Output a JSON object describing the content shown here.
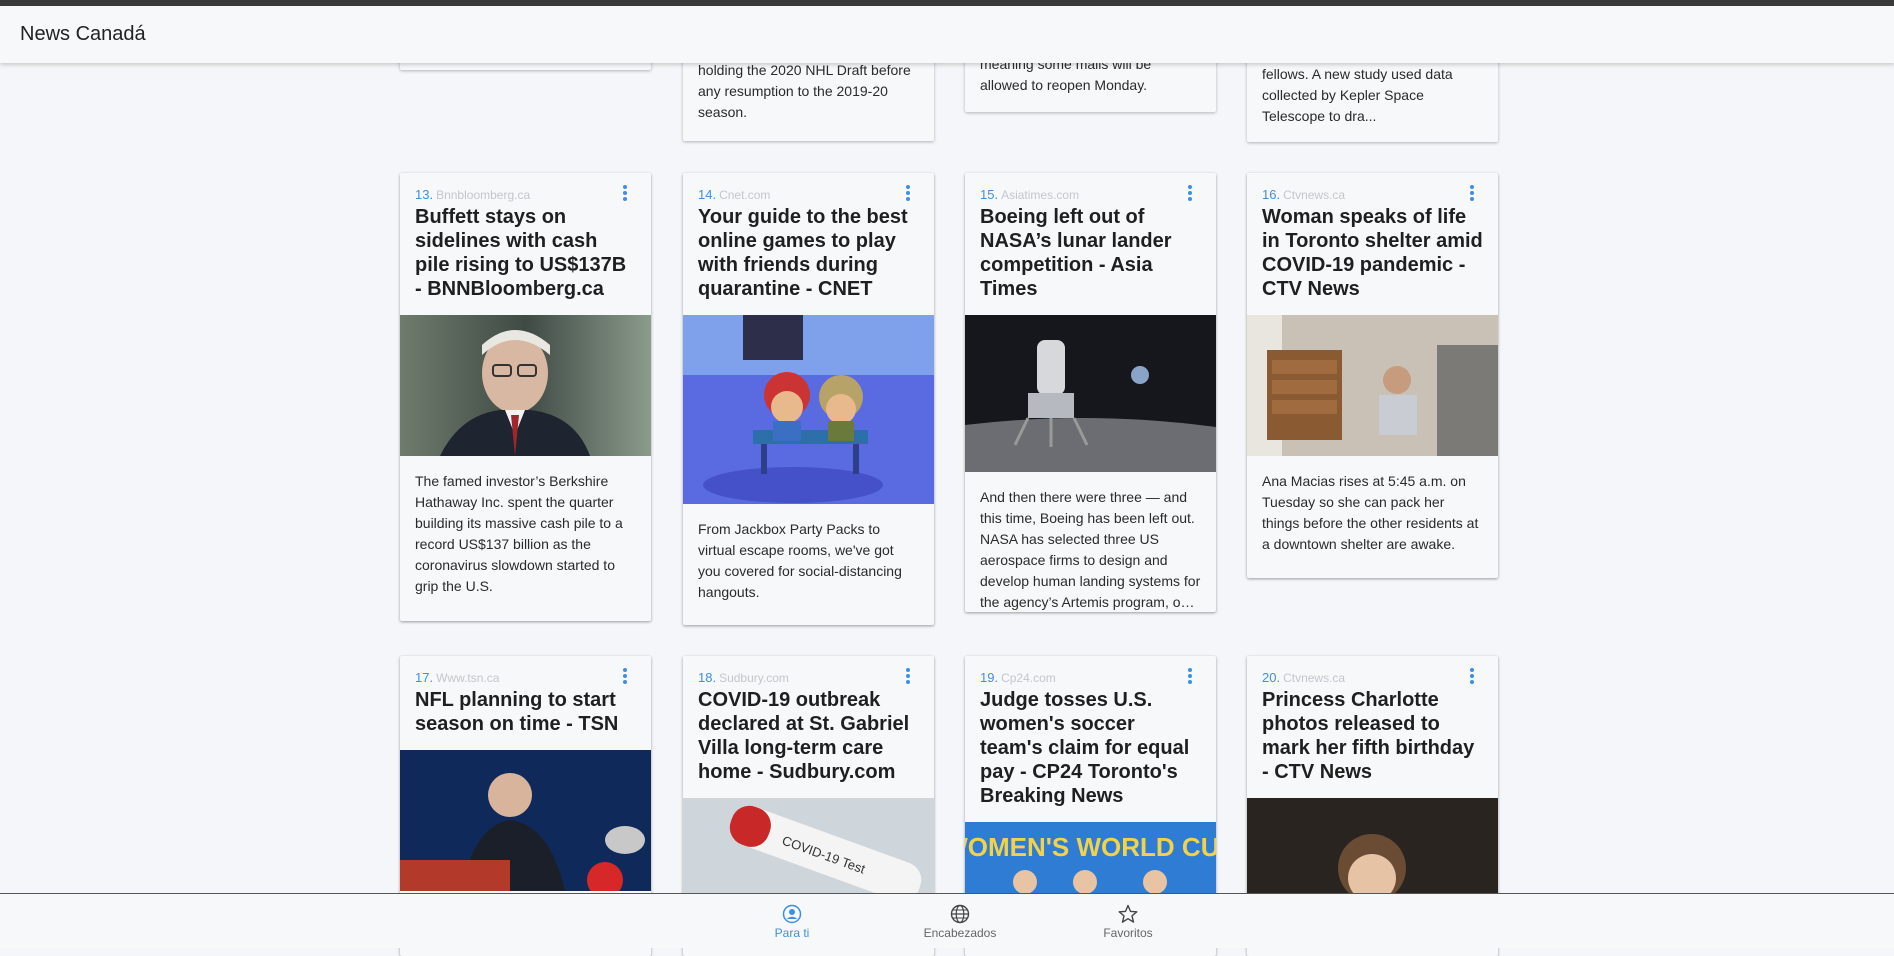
{
  "app": {
    "title": "News Canadá"
  },
  "partial_cards": [
    {
      "desc": ""
    },
    {
      "desc": "holding the 2020 NHL Draft before any resumption to the 2019-20 season."
    },
    {
      "desc": "meaning some malls will be allowed to reopen Monday."
    },
    {
      "desc": "fellows. A new study used data collected by Kepler Space Telescope to dra..."
    }
  ],
  "cards": [
    {
      "num": "13.",
      "source": "Bnnbloomberg.ca",
      "title": "Buffett stays on sidelines with cash pile rising to US$137B - BNNBloomberg.ca",
      "desc": "The famed investor’s Berkshire Hathaway Inc. spent the quarter building its massive cash pile to a record US$137 billion as the coronavirus slowdown started to grip the U.S."
    },
    {
      "num": "14.",
      "source": "Cnet.com",
      "title": "Your guide to the best online games to play with friends during quarantine - CNET",
      "desc": "From Jackbox Party Packs to virtual escape rooms, we've got you covered for social-distancing hangouts."
    },
    {
      "num": "15.",
      "source": "Asiatimes.com",
      "title": "Boeing left out of NASA’s lunar lander competition - Asia Times",
      "desc": "And then there were three — and this time, Boeing has been left out. NASA has selected three US aerospace firms to design and develop human landing systems for the agency’s Artemis program, o…"
    },
    {
      "num": "16.",
      "source": "Ctvnews.ca",
      "title": "Woman speaks of life in Toronto shelter amid COVID-19 pandemic - CTV News",
      "desc": "Ana Macias rises at 5:45 a.m. on Tuesday so she can pack her things before the other residents at a downtown shelter are awake."
    },
    {
      "num": "17.",
      "source": "Www.tsn.ca",
      "title": "NFL planning to start season on time - TSN",
      "desc": ""
    },
    {
      "num": "18.",
      "source": "Sudbury.com",
      "title": "COVID-19 outbreak declared at St. Gabriel Villa long-term care home - Sudbury.com",
      "desc": "",
      "image_text": "COVID-19 Test"
    },
    {
      "num": "19.",
      "source": "Cp24.com",
      "title": "Judge tosses U.S. women's soccer team's claim for equal pay - CP24 Toronto's Breaking News",
      "desc": "",
      "image_text": "WOMEN'S WORLD CUP"
    },
    {
      "num": "20.",
      "source": "Ctvnews.ca",
      "title": "Princess Charlotte photos released to mark her fifth birthday - CTV News",
      "desc": ""
    }
  ],
  "bottom_nav": [
    {
      "label": "Para ti",
      "icon": "person-circle-icon",
      "active": true
    },
    {
      "label": "Encabezados",
      "icon": "globe-icon",
      "active": false
    },
    {
      "label": "Favoritos",
      "icon": "star-icon",
      "active": false
    }
  ],
  "colors": {
    "accent": "#3f8fe4",
    "background": "#f4f6f9",
    "card": "#f7f8fa"
  }
}
